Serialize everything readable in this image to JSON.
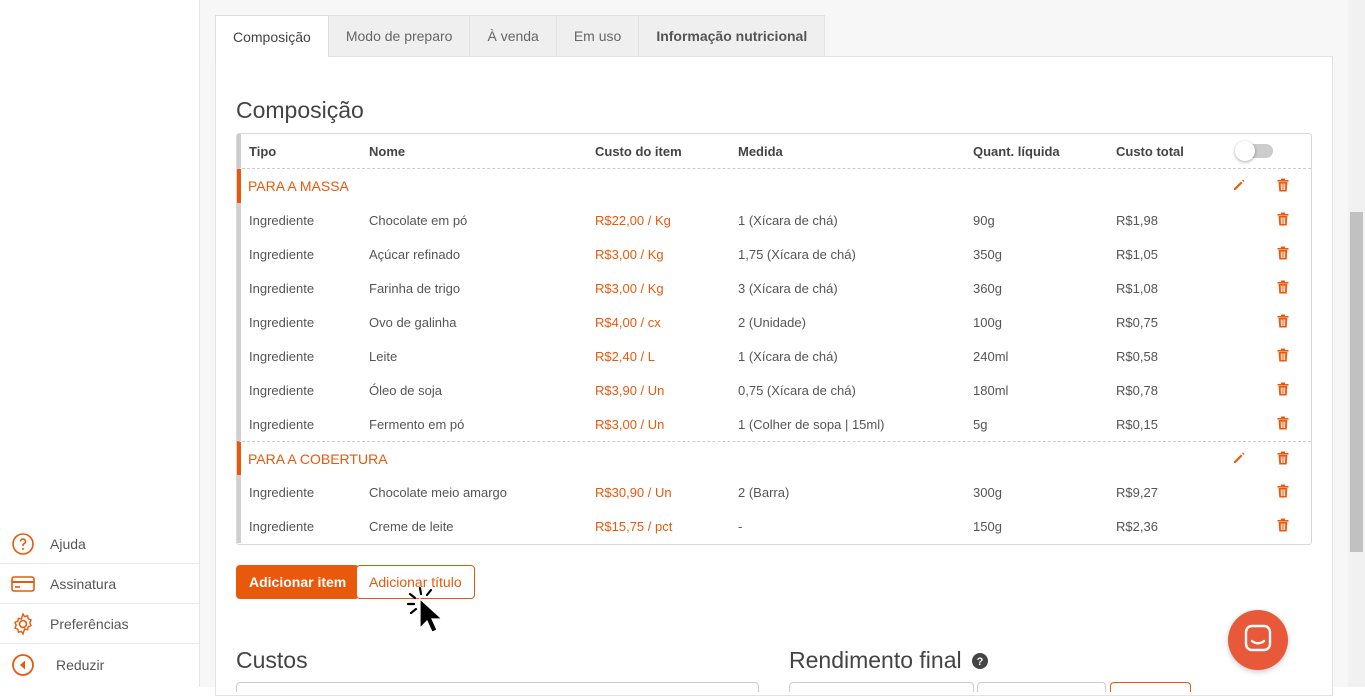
{
  "sidebar": {
    "items": [
      {
        "label": "Ajuda",
        "icon": "help-icon"
      },
      {
        "label": "Assinatura",
        "icon": "credit-card-icon"
      },
      {
        "label": "Preferências",
        "icon": "gear-icon"
      },
      {
        "label": "Reduzir",
        "icon": "collapse-icon"
      }
    ]
  },
  "tabs": [
    {
      "label": "Composição",
      "active": true
    },
    {
      "label": "Modo de preparo"
    },
    {
      "label": "À venda"
    },
    {
      "label": "Em uso"
    },
    {
      "label": "Informação nutricional",
      "bold": true
    }
  ],
  "composition": {
    "title": "Composição",
    "headers": [
      "Tipo",
      "Nome",
      "Custo do item",
      "Medida",
      "Quant. líquida",
      "Custo total"
    ],
    "sections": [
      {
        "title": "PARA A MASSA",
        "rows": [
          [
            "Ingrediente",
            "Chocolate em pó",
            "R$22,00 / Kg",
            "1 (Xícara de chá)",
            "90g",
            "R$1,98"
          ],
          [
            "Ingrediente",
            "Açúcar refinado",
            "R$3,00 / Kg",
            "1,75 (Xícara de chá)",
            "350g",
            "R$1,05"
          ],
          [
            "Ingrediente",
            "Farinha de trigo",
            "R$3,00 / Kg",
            "3 (Xícara de chá)",
            "360g",
            "R$1,08"
          ],
          [
            "Ingrediente",
            "Ovo de galinha",
            "R$4,00 / cx",
            "2 (Unidade)",
            "100g",
            "R$0,75"
          ],
          [
            "Ingrediente",
            "Leite",
            "R$2,40 / L",
            "1 (Xícara de chá)",
            "240ml",
            "R$0,58"
          ],
          [
            "Ingrediente",
            "Óleo de soja",
            "R$3,90 / Un",
            "0,75 (Xícara de chá)",
            "180ml",
            "R$0,78"
          ],
          [
            "Ingrediente",
            "Fermento em pó",
            "R$3,00 / Un",
            "1 (Colher de sopa | 15ml)",
            "5g",
            "R$0,15"
          ]
        ]
      },
      {
        "title": "PARA A COBERTURA",
        "rows": [
          [
            "Ingrediente",
            "Chocolate meio amargo",
            "R$30,90 / Un",
            "2 (Barra)",
            "300g",
            "R$9,27"
          ],
          [
            "Ingrediente",
            "Creme de leite",
            "R$15,75 / pct",
            "-",
            "150g",
            "R$2,36"
          ]
        ]
      }
    ]
  },
  "buttons": {
    "add_item": "Adicionar item",
    "add_title": "Adicionar título"
  },
  "sections": {
    "costs": "Custos",
    "final_yield": "Rendimento final"
  },
  "colors": {
    "accent": "#e8590c",
    "chat": "#e8593a"
  }
}
